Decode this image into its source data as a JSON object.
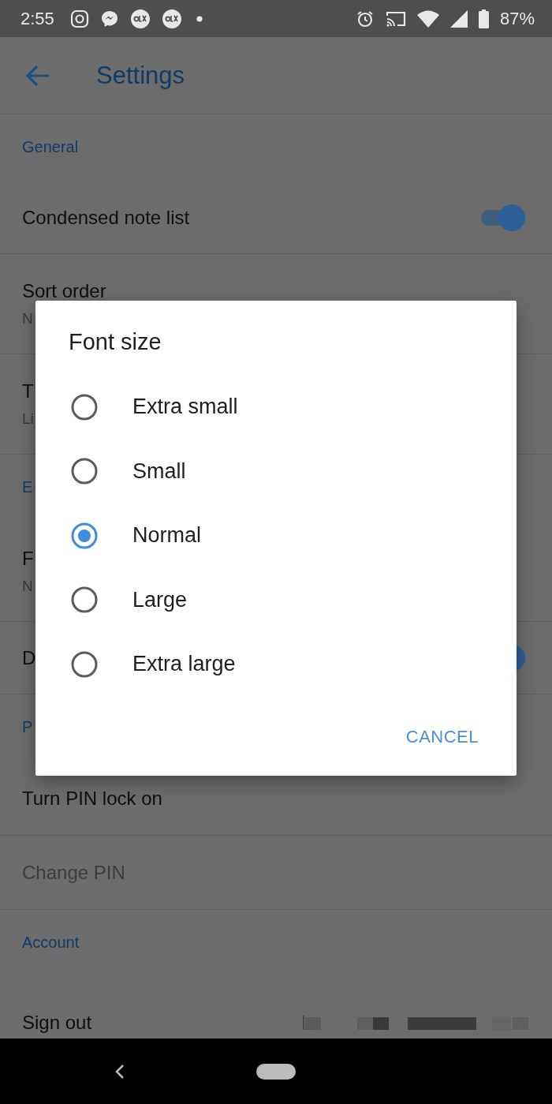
{
  "status_bar": {
    "time": "2:55",
    "battery": "87%"
  },
  "app_bar": {
    "title": "Settings"
  },
  "settings": [
    {
      "kind": "header",
      "label": "General"
    },
    {
      "kind": "toggle",
      "label": "Condensed note list",
      "on": true,
      "disabled": false
    },
    {
      "kind": "item",
      "label": "Sort order",
      "summary": "N",
      "disabled": false
    },
    {
      "kind": "item",
      "label": "T",
      "summary": "Li",
      "disabled": false
    },
    {
      "kind": "header",
      "label": "E"
    },
    {
      "kind": "item",
      "label": "F",
      "summary": "N",
      "disabled": false
    },
    {
      "kind": "toggle",
      "label": "D",
      "on": true,
      "disabled": false
    },
    {
      "kind": "header",
      "label": "P"
    },
    {
      "kind": "item",
      "label": "Turn PIN lock on",
      "disabled": false
    },
    {
      "kind": "item",
      "label": "Change PIN",
      "disabled": true
    },
    {
      "kind": "header",
      "label": "Account"
    },
    {
      "kind": "account",
      "label": "Sign out",
      "disabled": false
    }
  ],
  "dialog": {
    "title": "Font size",
    "options": [
      {
        "label": "Extra small",
        "selected": false
      },
      {
        "label": "Small",
        "selected": false
      },
      {
        "label": "Normal",
        "selected": true
      },
      {
        "label": "Large",
        "selected": false
      },
      {
        "label": "Extra large",
        "selected": false
      }
    ],
    "buttons": [
      "CANCEL"
    ]
  }
}
